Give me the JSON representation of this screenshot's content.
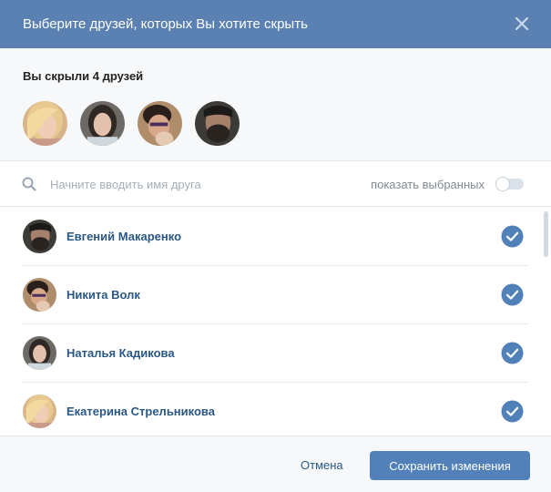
{
  "dialog": {
    "title": "Выберите друзей, которых Вы хотите скрыть",
    "close_icon": "close-icon"
  },
  "hidden_section": {
    "title": "Вы скрыли 4 друзей",
    "avatars": [
      "avatar-blonde-woman",
      "avatar-dark-hair-woman",
      "avatar-young-man",
      "avatar-bearded-man"
    ]
  },
  "search": {
    "placeholder": "Начните вводить имя друга",
    "value": "",
    "show_selected_label": "показать выбранных",
    "show_selected_on": false
  },
  "friends": [
    {
      "name": "Евгений Макаренко",
      "checked": true
    },
    {
      "name": "Никита Волк",
      "checked": true
    },
    {
      "name": "Наталья Кадикова",
      "checked": true
    },
    {
      "name": "Екатерина Стрельникова",
      "checked": true
    }
  ],
  "footer": {
    "cancel_label": "Отмена",
    "save_label": "Сохранить изменения"
  },
  "colors": {
    "header": "#5a81b2",
    "accent": "#5181b8",
    "link": "#2a5885"
  }
}
